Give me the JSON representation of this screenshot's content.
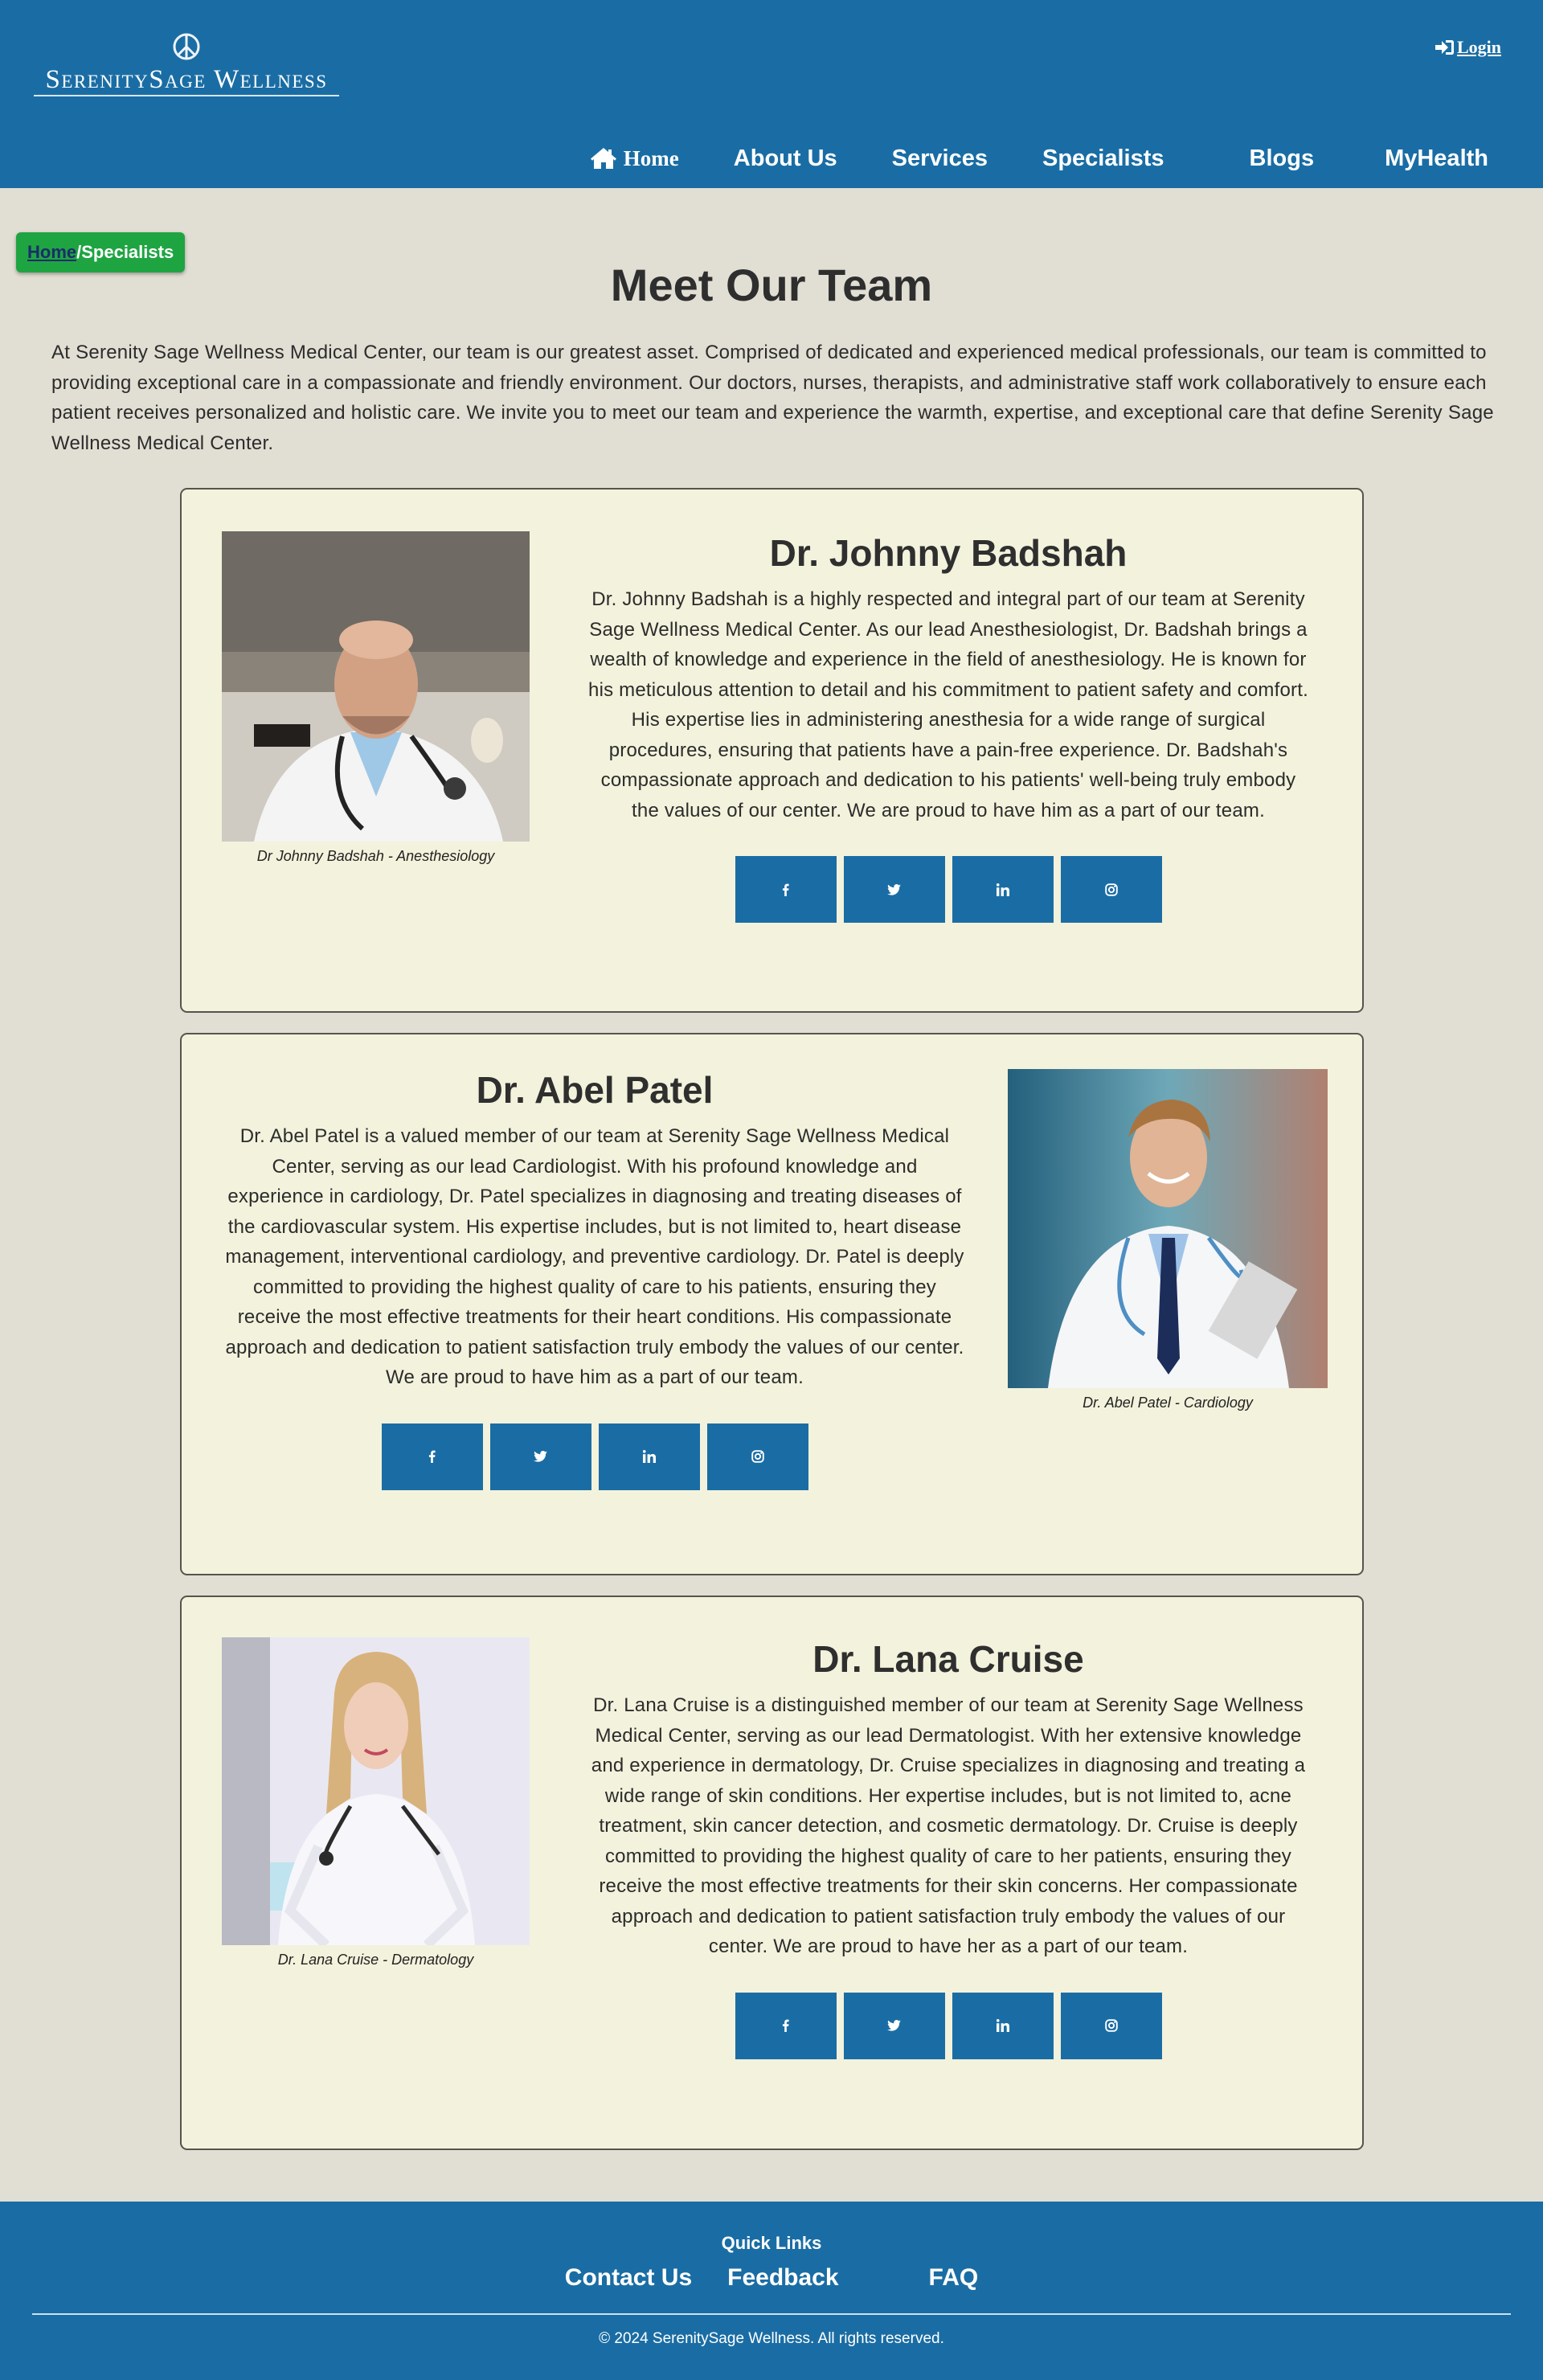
{
  "header": {
    "brand": "SerenitySage Wellness",
    "login_label": "Login",
    "nav": [
      {
        "label": "Home",
        "icon": "home-icon"
      },
      {
        "label": "About Us"
      },
      {
        "label": "Services"
      },
      {
        "label": "Specialists"
      },
      {
        "label": "Blogs"
      },
      {
        "label": "MyHealth"
      }
    ]
  },
  "breadcrumb": {
    "home": "Home",
    "current": "/Specialists"
  },
  "page": {
    "title": "Meet Our Team",
    "intro": "At Serenity Sage Wellness Medical Center, our team is our greatest asset. Comprised of dedicated and experienced medical professionals, our team is committed to providing exceptional care in a compassionate and friendly environment. Our doctors, nurses, therapists, and administrative staff work collaboratively to ensure each patient receives personalized and holistic care. We invite you to meet our team and experience the warmth, expertise, and exceptional care that define Serenity Sage Wellness Medical Center."
  },
  "doctors": [
    {
      "name": "Dr. Johnny Badshah",
      "caption": "Dr Johnny Badshah - Anesthesiology",
      "bio": "Dr. Johnny Badshah is a highly respected and integral part of our team at Serenity Sage Wellness Medical Center. As our lead Anesthesiologist, Dr. Badshah brings a wealth of knowledge and experience in the field of anesthesiology. He is known for his meticulous attention to detail and his commitment to patient safety and comfort. His expertise lies in administering anesthesia for a wide range of surgical procedures, ensuring that patients have a pain-free experience. Dr. Badshah's compassionate approach and dedication to his patients' well-being truly embody the values of our center. We are proud to have him as a part of our team."
    },
    {
      "name": "Dr. Abel Patel",
      "caption": "Dr. Abel Patel - Cardiology",
      "bio": "Dr. Abel Patel is a valued member of our team at Serenity Sage Wellness Medical Center, serving as our lead Cardiologist. With his profound knowledge and experience in cardiology, Dr. Patel specializes in diagnosing and treating diseases of the cardiovascular system. His expertise includes, but is not limited to, heart disease management, interventional cardiology, and preventive cardiology. Dr. Patel is deeply committed to providing the highest quality of care to his patients, ensuring they receive the most effective treatments for their heart conditions. His compassionate approach and dedication to patient satisfaction truly embody the values of our center. We are proud to have him as a part of our team."
    },
    {
      "name": "Dr. Lana Cruise",
      "caption": "Dr. Lana Cruise - Dermatology",
      "bio": "Dr. Lana Cruise is a distinguished member of our team at Serenity Sage Wellness Medical Center, serving as our lead Dermatologist. With her extensive knowledge and experience in dermatology, Dr. Cruise specializes in diagnosing and treating a wide range of skin conditions. Her expertise includes, but is not limited to, acne treatment, skin cancer detection, and cosmetic dermatology. Dr. Cruise is deeply committed to providing the highest quality of care to her patients, ensuring they receive the most effective treatments for their skin concerns. Her compassionate approach and dedication to patient satisfaction truly embody the values of our center. We are proud to have her as a part of our team."
    }
  ],
  "social_icons": [
    "facebook-icon",
    "twitter-icon",
    "linkedin-icon",
    "instagram-icon"
  ],
  "footer": {
    "quick_links_title": "Quick Links",
    "links": [
      "Contact Us",
      "Feedback",
      "FAQ"
    ],
    "copyright": "© 2024 SerenitySage Wellness. All rights reserved."
  },
  "colors": {
    "primary": "#1a6da4",
    "page_bg": "#e1ded3",
    "card_bg": "#f3f2dc",
    "breadcrumb": "#1fa442"
  }
}
